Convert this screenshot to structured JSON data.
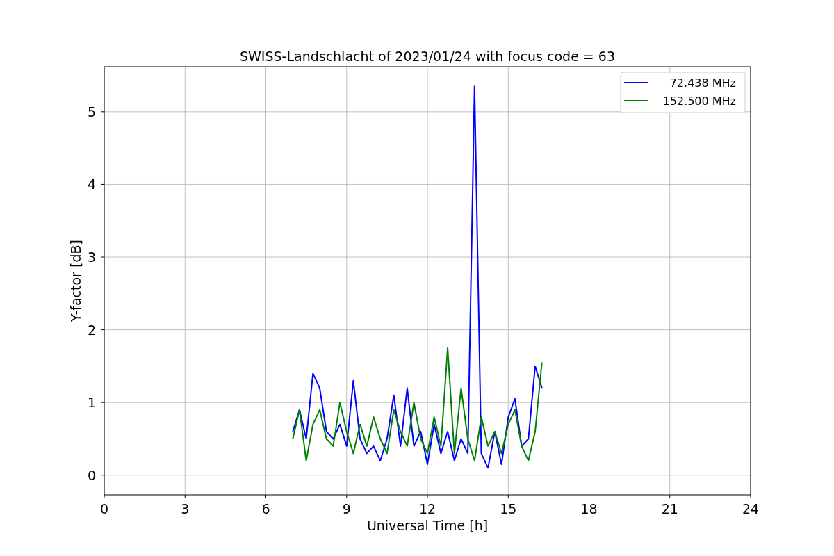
{
  "chart": {
    "chart_data": {
      "type": "line",
      "title": "SWISS-Landschlacht of 2023/01/24 with focus code = 63",
      "xlabel": "Universal Time [h]",
      "ylabel": "Y-factor [dB]",
      "x": [
        7.0,
        7.25,
        7.5,
        7.75,
        8.0,
        8.25,
        8.5,
        8.75,
        9.0,
        9.25,
        9.5,
        9.75,
        10.0,
        10.25,
        10.5,
        10.75,
        11.0,
        11.25,
        11.5,
        11.75,
        12.0,
        12.25,
        12.5,
        12.75,
        13.0,
        13.25,
        13.5,
        13.75,
        14.0,
        14.25,
        14.5,
        14.75,
        15.0,
        15.25,
        15.5,
        15.75,
        16.0,
        16.25
      ],
      "series": [
        {
          "name": "72.438 MHz",
          "color": "#0000ff",
          "values": [
            0.6,
            0.9,
            0.5,
            1.4,
            1.2,
            0.6,
            0.5,
            0.7,
            0.4,
            1.3,
            0.5,
            0.3,
            0.4,
            0.2,
            0.5,
            1.1,
            0.4,
            1.2,
            0.4,
            0.6,
            0.15,
            0.7,
            0.3,
            0.6,
            0.2,
            0.5,
            0.3,
            5.35,
            0.3,
            0.1,
            0.6,
            0.15,
            0.8,
            1.05,
            0.4,
            0.5,
            1.5,
            1.2
          ]
        },
        {
          "name": "152.500 MHz",
          "color": "#008000",
          "values": [
            0.5,
            0.9,
            0.2,
            0.7,
            0.9,
            0.5,
            0.4,
            1.0,
            0.6,
            0.3,
            0.7,
            0.4,
            0.8,
            0.5,
            0.3,
            0.9,
            0.6,
            0.4,
            1.0,
            0.5,
            0.3,
            0.8,
            0.4,
            1.75,
            0.3,
            1.2,
            0.5,
            0.2,
            0.8,
            0.4,
            0.6,
            0.3,
            0.7,
            0.9,
            0.4,
            0.2,
            0.6,
            1.55
          ]
        }
      ],
      "grid": true,
      "legend": "upper right",
      "xlim": [
        0,
        24
      ],
      "ylim": [
        -0.27,
        5.62
      ],
      "xticks": [
        0,
        3,
        6,
        9,
        12,
        15,
        18,
        21,
        24
      ],
      "yticks": [
        0,
        1,
        2,
        3,
        4,
        5
      ]
    }
  }
}
